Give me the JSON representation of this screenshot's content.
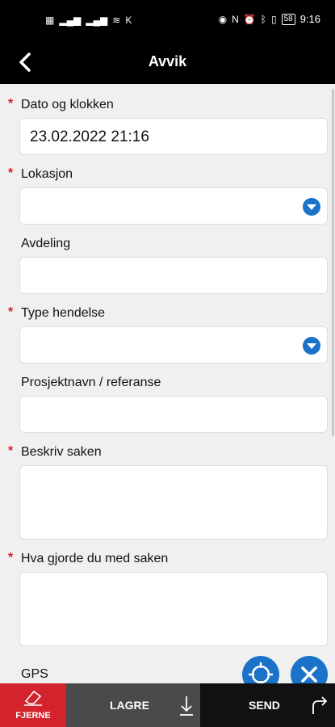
{
  "status_bar": {
    "time": "9:16",
    "battery": "58"
  },
  "app_bar": {
    "title": "Avvik"
  },
  "form": {
    "date": {
      "label": "Dato og klokken",
      "value": "23.02.2022 21:16",
      "required_mark": "*"
    },
    "location": {
      "label": "Lokasjon",
      "required_mark": "*"
    },
    "department": {
      "label": "Avdeling"
    },
    "event_type": {
      "label": "Type hendelse",
      "required_mark": "*"
    },
    "project": {
      "label": "Prosjektnavn / referanse"
    },
    "describe": {
      "label": "Beskriv saken",
      "required_mark": "*"
    },
    "action": {
      "label": "Hva gjorde du med saken",
      "required_mark": "*"
    },
    "gps": {
      "label": "GPS"
    }
  },
  "bottom_bar": {
    "remove_label": "FJERNE",
    "save_label": "LAGRE",
    "send_label": "SEND"
  },
  "colors": {
    "accent": "#1a73c9",
    "required": "#d3232c",
    "remove_bg": "#d3232c",
    "save_bg": "#4a4a4a",
    "send_bg": "#111111"
  }
}
